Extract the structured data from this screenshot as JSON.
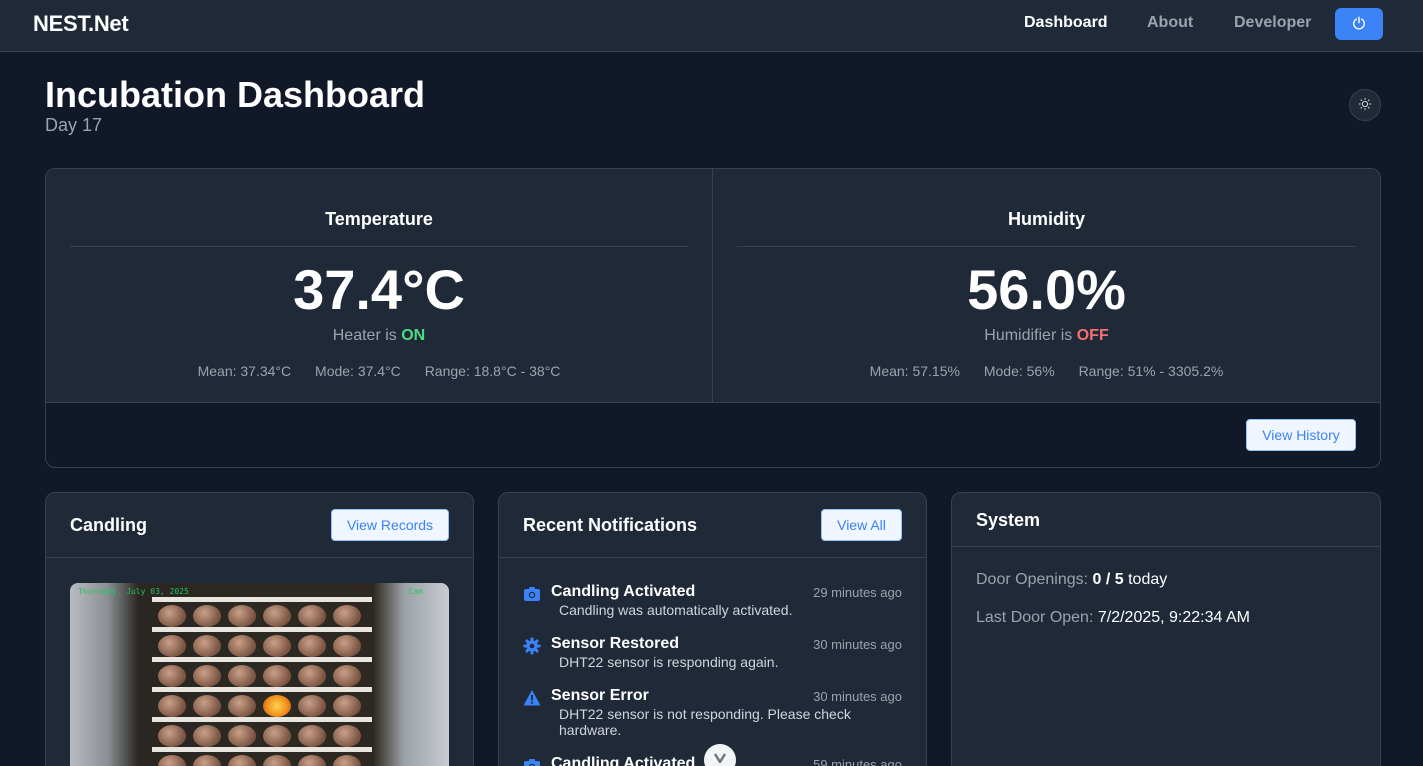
{
  "nav": {
    "brand": "NEST.Net",
    "links": [
      "Dashboard",
      "About",
      "Developer"
    ],
    "power_icon": "power-icon",
    "accent": "#3b82f6"
  },
  "header": {
    "title": "Incubation Dashboard",
    "subtitle": "Day 17",
    "theme_icon": "sun-icon"
  },
  "temperature": {
    "title": "Temperature",
    "value": "37.4°C",
    "status_prefix": "Heater is",
    "status": "ON",
    "mean": "Mean: 37.34°C",
    "mode": "Mode: 37.4°C",
    "range": "Range: 18.8°C - 38°C",
    "status_color": "#4ade80"
  },
  "humidity": {
    "title": "Humidity",
    "value": "56.0%",
    "status_prefix": "Humidifier is",
    "status": "OFF",
    "mean": "Mean: 57.15%",
    "mode": "Mode: 56%",
    "range": "Range: 51% - 3305.2%",
    "status_color": "#f87171"
  },
  "sensor_card": {
    "history_button": "View History"
  },
  "candling": {
    "title": "Candling",
    "records_button": "View Records",
    "camera_timestamp": "Thursday, July 03, 2025",
    "camera_label": "Cam"
  },
  "notifications": {
    "title": "Recent Notifications",
    "view_all_button": "View All",
    "items": [
      {
        "icon": "camera-icon",
        "title": "Candling Activated",
        "time": "29 minutes ago",
        "message": "Candling was automatically activated."
      },
      {
        "icon": "gear-icon",
        "title": "Sensor Restored",
        "time": "30 minutes ago",
        "message": "DHT22 sensor is responding again."
      },
      {
        "icon": "warning-icon",
        "title": "Sensor Error",
        "time": "30 minutes ago",
        "message": "DHT22 sensor is not responding. Please check hardware."
      },
      {
        "icon": "camera-icon",
        "title": "Candling Activated",
        "time": "59 minutes ago",
        "message": ""
      }
    ]
  },
  "system": {
    "title": "System",
    "door_label": "Door Openings:",
    "door_value": "0 / 5",
    "door_suffix": "today",
    "last_door_label": "Last Door Open:",
    "last_door_value": "7/2/2025, 9:22:34 AM"
  }
}
